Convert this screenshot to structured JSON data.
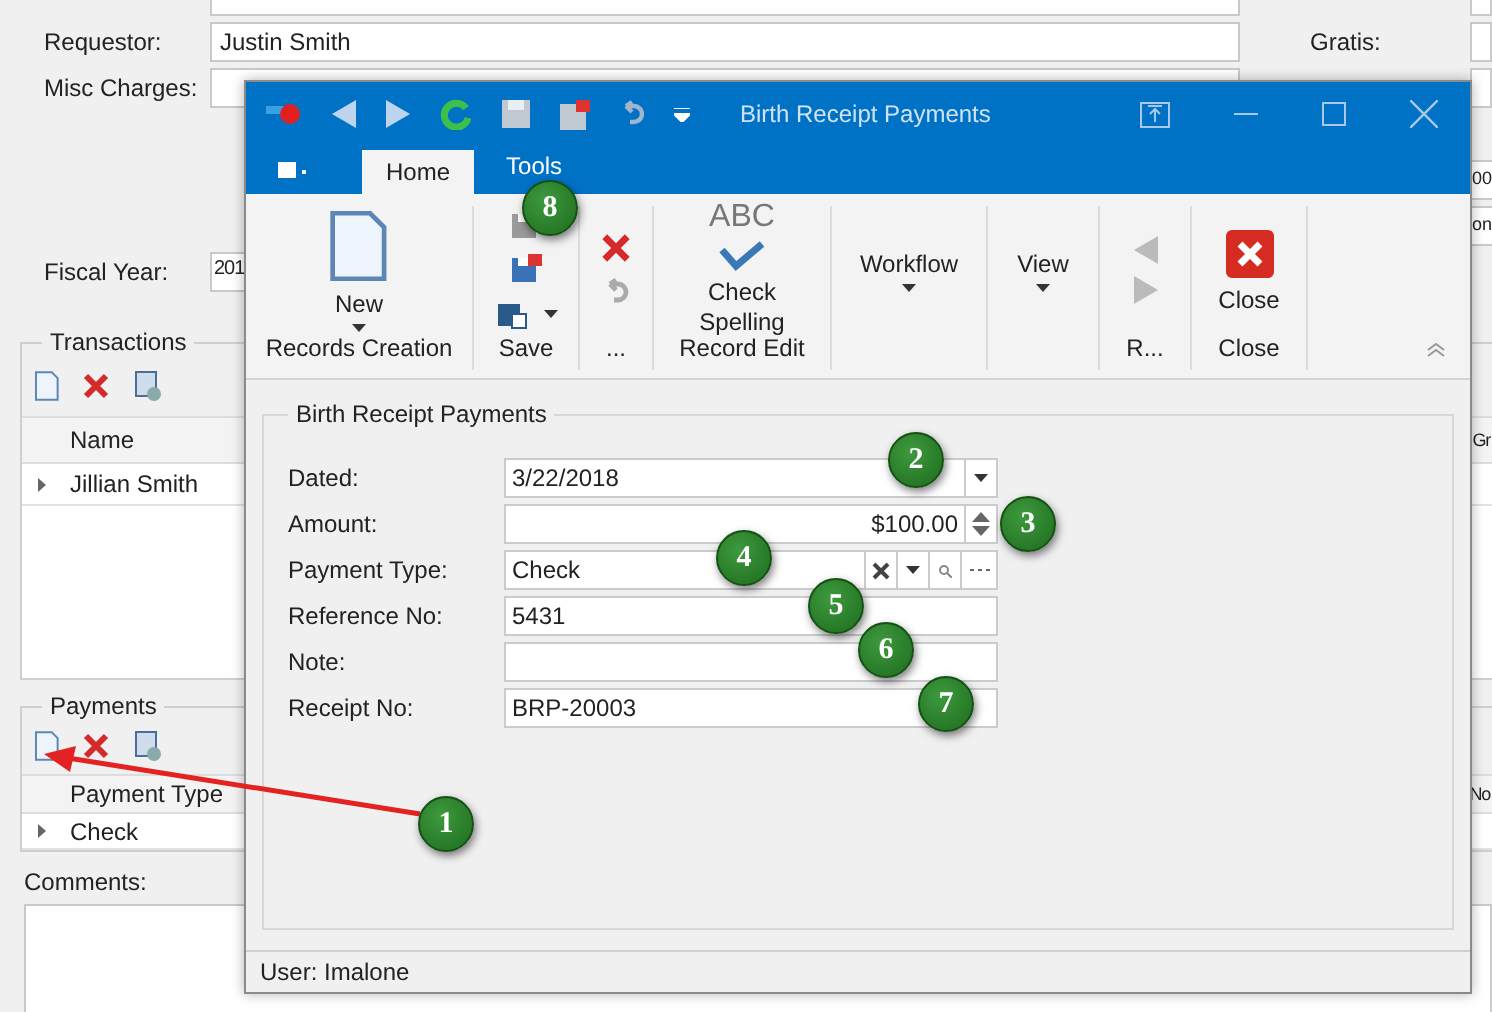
{
  "form": {
    "requestor": {
      "label": "Requestor:",
      "value": "Justin Smith"
    },
    "misc_charges": {
      "label": "Misc Charges:"
    },
    "fiscal_year": {
      "label": "Fiscal Year:",
      "value": "201"
    },
    "gratis": {
      "label": "Gratis:"
    },
    "right_values": [
      "00",
      "on"
    ]
  },
  "transactions": {
    "title": "Transactions",
    "columns": [
      "Name"
    ],
    "rows": [
      "Jillian Smith"
    ],
    "column_2": "Gr"
  },
  "payments": {
    "title": "Payments",
    "columns": [
      "Payment Type"
    ],
    "rows": [
      "Check"
    ],
    "column_2": "No"
  },
  "comments": {
    "label": "Comments:"
  },
  "dialog": {
    "title": "Birth Receipt Payments",
    "tabs": [
      {
        "label": "Home",
        "selected": true
      },
      {
        "label": "Tools",
        "selected": false
      }
    ],
    "groups": [
      {
        "kind": "new",
        "label": "New",
        "caption": "Records Creation"
      },
      {
        "kind": "save",
        "caption": "Save"
      },
      {
        "kind": "edit",
        "caption": "..."
      },
      {
        "kind": "spell",
        "icon_text": "ABC",
        "label": "Check Spelling",
        "caption": "Record Edit"
      },
      {
        "kind": "menu",
        "label": "Workflow"
      },
      {
        "kind": "menu",
        "label": "View"
      },
      {
        "kind": "nav",
        "caption": "R..."
      },
      {
        "kind": "close",
        "label": "Close",
        "caption": "Close"
      }
    ],
    "section": "Birth Receipt Payments",
    "fields": [
      {
        "kind": "date",
        "label": "Dated:",
        "value": "3/22/2018"
      },
      {
        "kind": "spin",
        "label": "Amount:",
        "value": "$100.00"
      },
      {
        "kind": "lookup",
        "label": "Payment Type:",
        "value": "Check"
      },
      {
        "kind": "text",
        "label": "Reference No:",
        "value": "5431"
      },
      {
        "kind": "text",
        "label": "Note:"
      },
      {
        "kind": "text",
        "label": "Receipt No:",
        "value": "BRP-20003"
      }
    ],
    "status": "User: Imalone"
  },
  "callouts": [
    "1",
    "2",
    "3",
    "4",
    "5",
    "6",
    "7",
    "8"
  ]
}
